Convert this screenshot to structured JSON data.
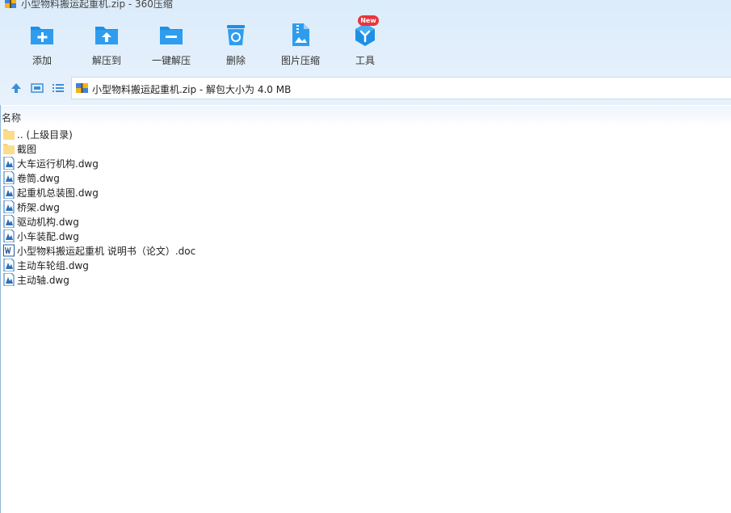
{
  "window": {
    "title": "小型物料搬运起重机.zip - 360压缩",
    "app_icon": "archive-icon"
  },
  "toolbar": {
    "items": [
      {
        "label": "添加",
        "icon": "add-folder-icon"
      },
      {
        "label": "解压到",
        "icon": "extract-to-icon"
      },
      {
        "label": "一键解压",
        "icon": "one-click-extract-icon"
      },
      {
        "label": "删除",
        "icon": "delete-icon"
      },
      {
        "label": "图片压缩",
        "icon": "image-compress-icon"
      },
      {
        "label": "工具",
        "icon": "tools-icon",
        "badge": "New"
      }
    ]
  },
  "navbar": {
    "path_text": "小型物料搬运起重机.zip - 解包大小为 4.0 MB"
  },
  "columns": {
    "name": "名称"
  },
  "files": [
    {
      "name": ".. (上级目录)",
      "type": "folder"
    },
    {
      "name": "截图",
      "type": "folder"
    },
    {
      "name": "大车运行机构.dwg",
      "type": "dwg"
    },
    {
      "name": "卷筒.dwg",
      "type": "dwg"
    },
    {
      "name": "起重机总装图.dwg",
      "type": "dwg"
    },
    {
      "name": "桥架.dwg",
      "type": "dwg"
    },
    {
      "name": "驱动机构.dwg",
      "type": "dwg"
    },
    {
      "name": "小车装配.dwg",
      "type": "dwg"
    },
    {
      "name": "小型物料搬运起重机 说明书（论文）.doc",
      "type": "doc"
    },
    {
      "name": "主动车轮组.dwg",
      "type": "dwg"
    },
    {
      "name": "主动轴.dwg",
      "type": "dwg"
    }
  ],
  "colors": {
    "accent": "#1e8fe6",
    "toolbar_bg": "#dcecfb",
    "badge": "#e8353d",
    "folder": "#f7d37a"
  }
}
